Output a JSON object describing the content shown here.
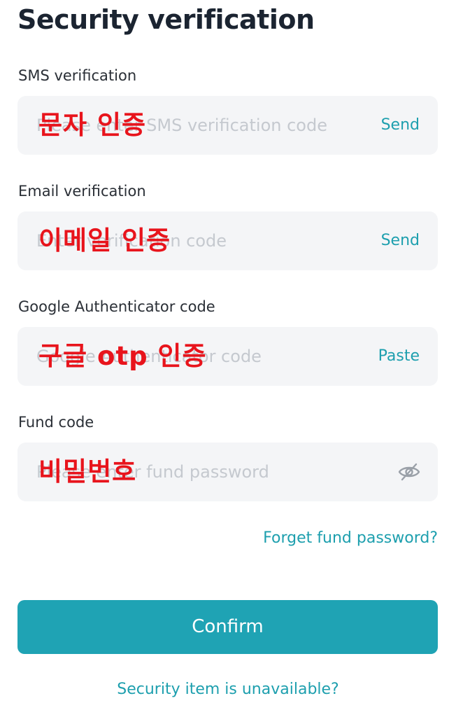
{
  "page_title": "Security verification",
  "fields": [
    {
      "label": "SMS verification",
      "placeholder": "Please enter SMS verification code",
      "overlay": "문자 인증",
      "action": "Send"
    },
    {
      "label": "Email verification",
      "placeholder": "Enter verification code",
      "overlay": "이메일 인증",
      "action": "Send"
    },
    {
      "label": "Google Authenticator code",
      "placeholder": "Google Authenticator code",
      "overlay": "구글 otp 인증",
      "action": "Paste"
    },
    {
      "label": "Fund code",
      "placeholder": "Please enter fund password",
      "overlay": "비밀번호",
      "icon": "eye-slash-icon"
    }
  ],
  "forget_link": "Forget fund password?",
  "confirm_label": "Confirm",
  "unavailable_link": "Security item is unavailable?",
  "colors": {
    "accent": "#1fa3b4",
    "link": "#1d9fae",
    "field_bg": "#f4f5f7",
    "overlay_text": "#e8141c"
  }
}
